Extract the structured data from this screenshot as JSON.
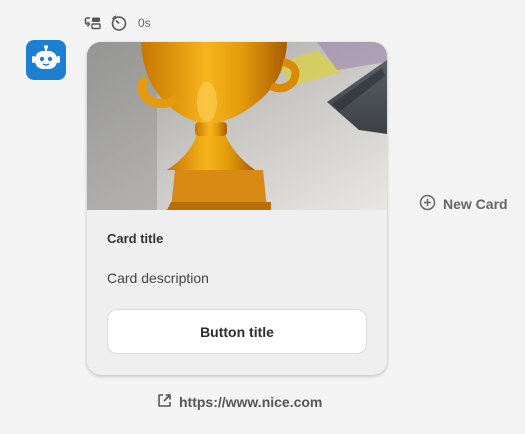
{
  "toolbar": {
    "icons": [
      "repeat-message-icon",
      "timer-icon"
    ],
    "elapsed": "0s"
  },
  "bot": {
    "avatar_icon": "robot-icon",
    "color": "#1d7fd1"
  },
  "card": {
    "image_icon": "trophy-photo",
    "title": "Card title",
    "description": "Card description",
    "button_label": "Button title"
  },
  "actions": {
    "new_card_label": "New Card",
    "new_card_icon": "plus-circle-icon"
  },
  "link": {
    "icon": "external-link-icon",
    "url": "https://www.nice.com"
  }
}
